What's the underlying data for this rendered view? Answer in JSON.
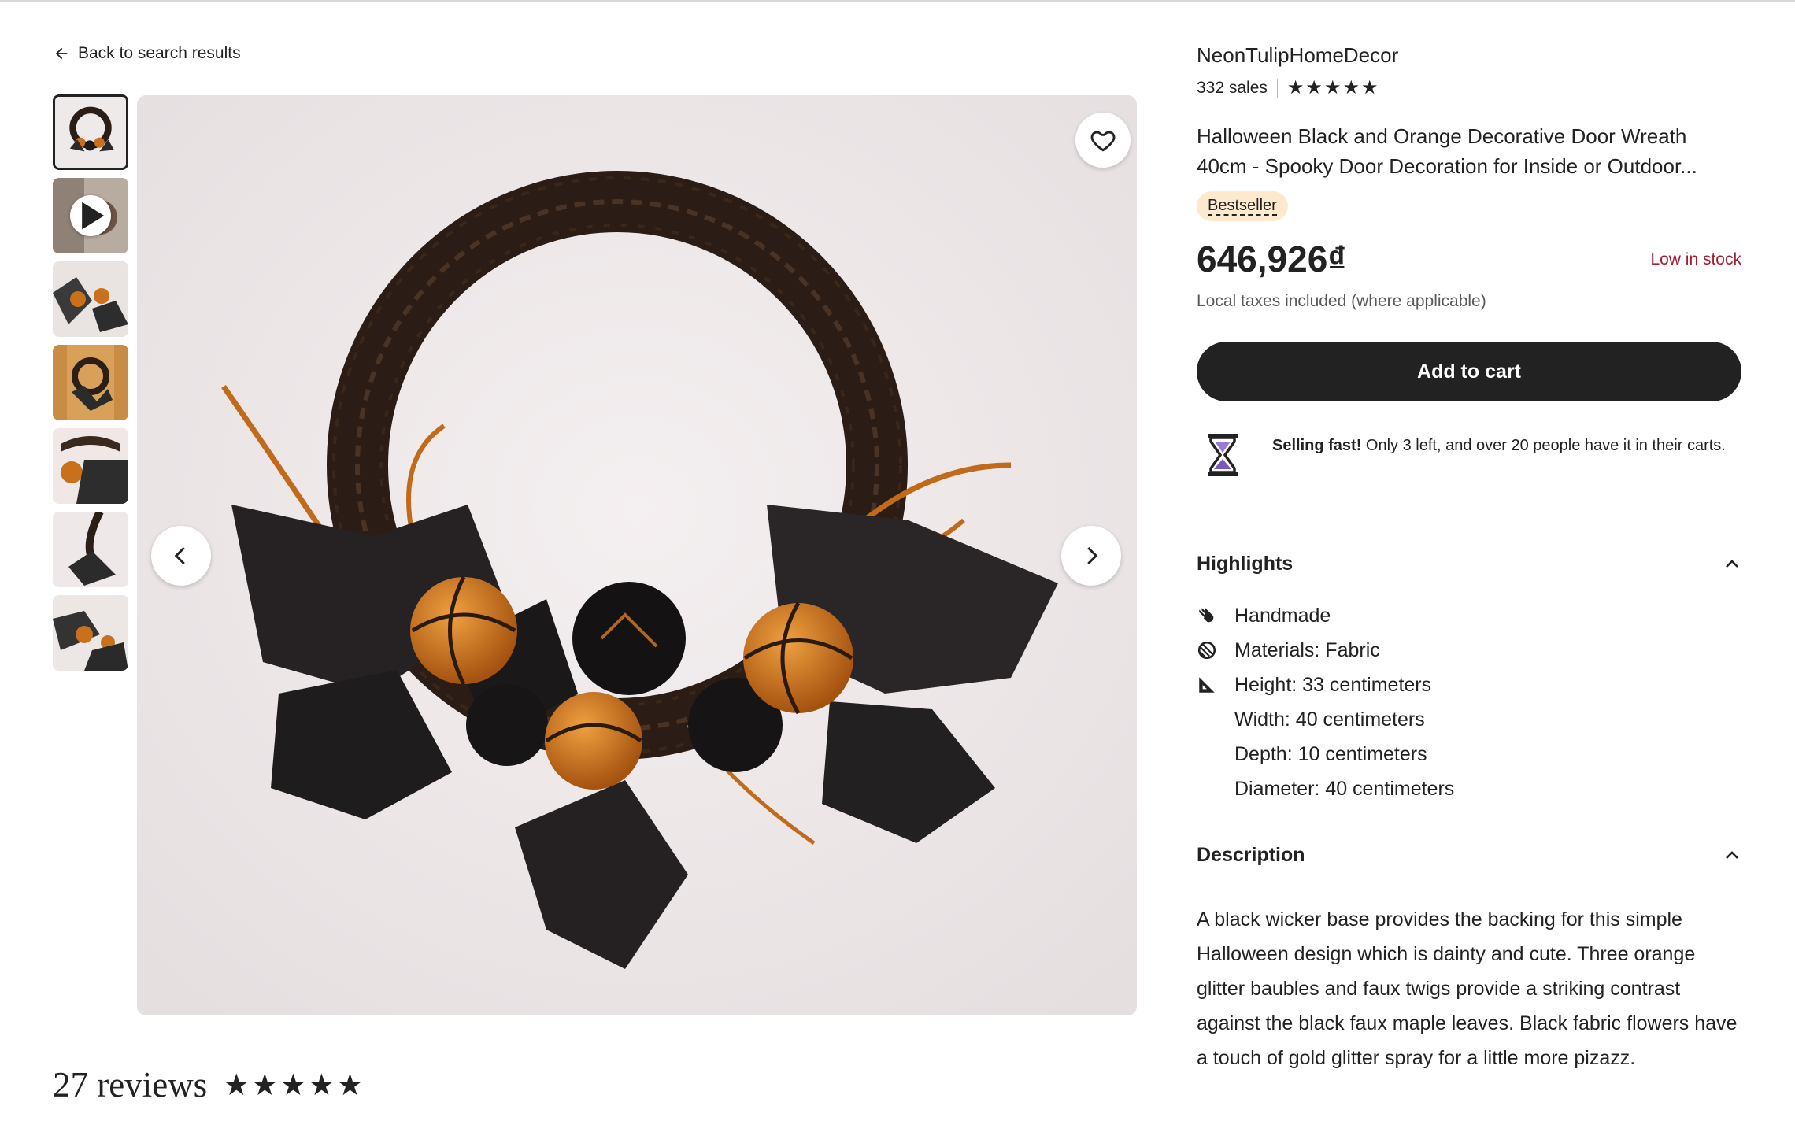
{
  "nav": {
    "back_label": "Back to search results"
  },
  "gallery": {
    "thumbnail_count": 7
  },
  "reviews": {
    "count_label": "27 reviews",
    "stars": "★★★★★",
    "rating": 5
  },
  "shop": {
    "name": "NeonTulipHomeDecor",
    "sales": "332 sales",
    "stars": "★★★★★",
    "rating": 5
  },
  "product": {
    "title": "Halloween Black and Orange Decorative Door Wreath 40cm - Spooky Door Decoration for Inside or Outdoor...",
    "badge": "Bestseller",
    "price": "646,926₫",
    "stock": "Low in stock",
    "taxes_note": "Local taxes included (where applicable)",
    "add_to_cart": "Add to cart",
    "selling_fast_bold": "Selling fast!",
    "selling_fast_text": " Only 3 left, and over 20 people have it in their carts."
  },
  "highlights": {
    "heading": "Highlights",
    "items": [
      "Handmade",
      "Materials: Fabric",
      "Height: 33 centimeters",
      "Width: 40 centimeters",
      "Depth: 10 centimeters",
      "Diameter: 40 centimeters"
    ]
  },
  "description": {
    "heading": "Description",
    "text": "A black wicker base provides the backing for this simple Halloween design which is dainty and cute. Three orange glitter baubles and faux twigs provide a striking contrast against the black faux maple leaves. Black fabric flowers have a touch of gold glitter spray for a little more pizazz."
  },
  "colors": {
    "text": "#222222",
    "stock_red": "#a61a2e",
    "badge_bg": "#fde9ce",
    "button_bg": "#222222",
    "muted": "#595959"
  }
}
